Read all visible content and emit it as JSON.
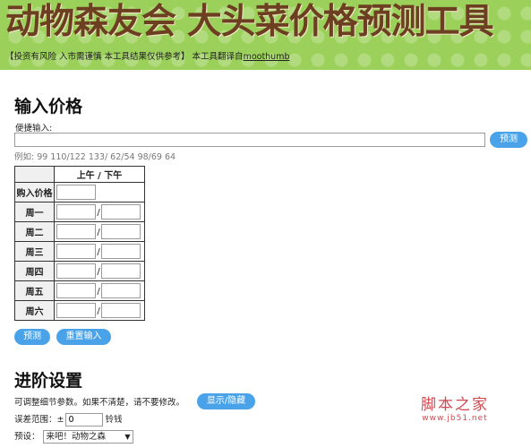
{
  "banner": {
    "title": "动物森友会 大头菜价格预测工具",
    "disclaimer_prefix": "【投资有风险 入市需谨慎 本工具结果仅供参考】 本工具翻译自",
    "disclaimer_link": "moothumb"
  },
  "input_section": {
    "title": "输入价格",
    "quick_label": "便捷输入:",
    "quick_value": "",
    "quick_predict_label": "预测",
    "example": "例如: 99 110/122 133/ 62/54 98/69 64"
  },
  "table": {
    "header": "上午 / 下午",
    "buy_label": "购入价格",
    "days": [
      {
        "label": "周一",
        "am": "",
        "pm": ""
      },
      {
        "label": "周二",
        "am": "",
        "pm": ""
      },
      {
        "label": "周三",
        "am": "",
        "pm": ""
      },
      {
        "label": "周四",
        "am": "",
        "pm": ""
      },
      {
        "label": "周五",
        "am": "",
        "pm": ""
      },
      {
        "label": "周六",
        "am": "",
        "pm": ""
      }
    ],
    "slash": "/"
  },
  "actions": {
    "predict_label": "预测",
    "reset_label": "重置输入"
  },
  "advanced": {
    "title": "进阶设置",
    "description": "可调整细节参数。如果不清楚，请不要修改。",
    "toggle_label": "显示/隐藏",
    "error_label": "误差范围：±",
    "error_value": "0",
    "error_unit": "铃钱",
    "preset_label": "预设：",
    "preset_value": "来吧！动物之森"
  },
  "watermark": {
    "main": "脚本之家",
    "sub": "www.jb51.net"
  },
  "colors": {
    "banner_green": "#9bd15a",
    "title_brown": "#6b3f1f",
    "button_blue": "#4aa3e8",
    "watermark_red": "#d04a52"
  }
}
